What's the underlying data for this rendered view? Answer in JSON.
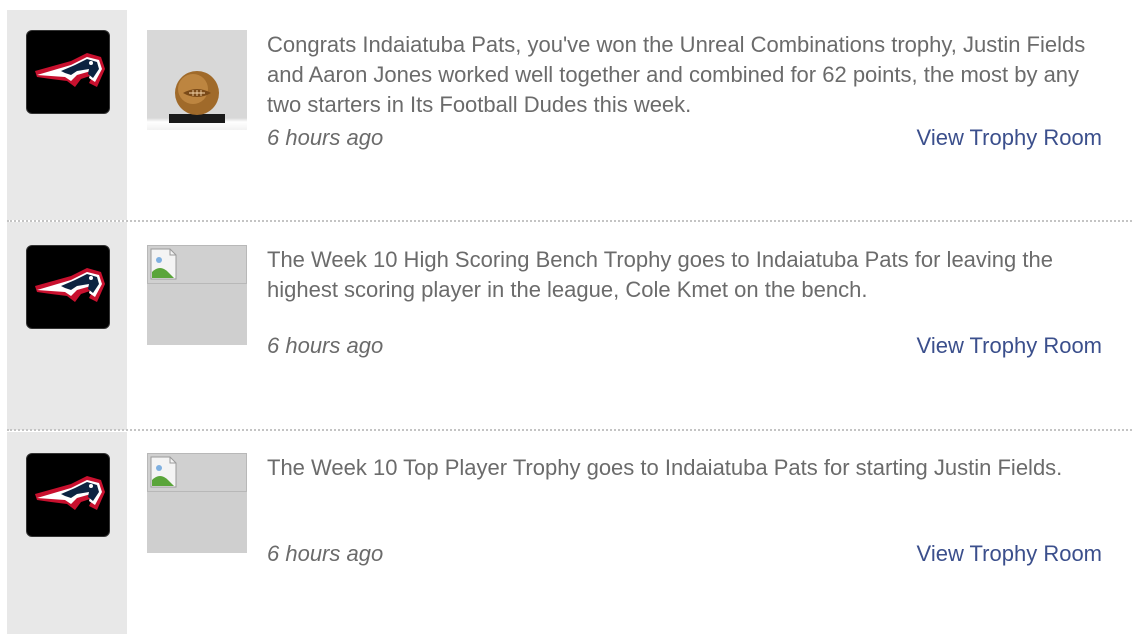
{
  "feed": {
    "items": [
      {
        "team_logo_icon": "patriots-logo-icon",
        "trophy_icon": "football-trophy-icon",
        "message": "Congrats Indaiatuba Pats, you've won the Unreal Combinations trophy, Justin Fields and Aaron Jones worked well together and combined for 62 points, the most by any two starters in Its Football Dudes this week.",
        "time": "6 hours ago",
        "link": "View Trophy Room"
      },
      {
        "team_logo_icon": "patriots-logo-icon",
        "trophy_icon": "broken-image-icon",
        "message": "The Week 10 High Scoring Bench Trophy goes to Indaiatuba Pats for leaving the highest scoring player in the league, Cole Kmet on the bench.",
        "time": "6 hours ago",
        "link": "View Trophy Room"
      },
      {
        "team_logo_icon": "patriots-logo-icon",
        "trophy_icon": "broken-image-icon",
        "message": "The Week 10 Top Player Trophy goes to Indaiatuba Pats for starting Justin Fields.",
        "time": "6 hours ago",
        "link": "View Trophy Room"
      }
    ]
  },
  "colors": {
    "link": "#3b4f8c",
    "text": "#6b6b6b",
    "gutter": "#e8e8e8",
    "avatar_bg": "#000000"
  }
}
